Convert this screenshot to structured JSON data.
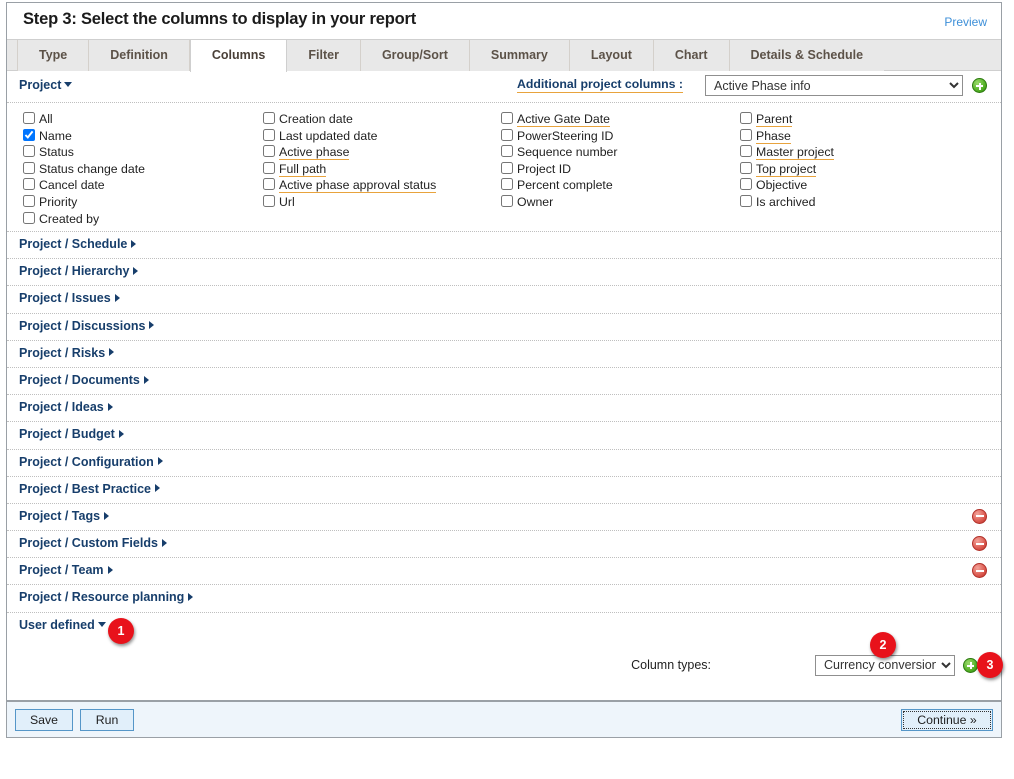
{
  "header": {
    "title": "Step 3: Select the columns to display in your report",
    "preview_label": "Preview"
  },
  "tabs": [
    {
      "label": "Type",
      "active": false
    },
    {
      "label": "Definition",
      "active": false
    },
    {
      "label": "Columns",
      "active": true
    },
    {
      "label": "Filter",
      "active": false
    },
    {
      "label": "Group/Sort",
      "active": false
    },
    {
      "label": "Summary",
      "active": false
    },
    {
      "label": "Layout",
      "active": false
    },
    {
      "label": "Chart",
      "active": false
    },
    {
      "label": "Details & Schedule",
      "active": false
    }
  ],
  "subbar": {
    "group_label": "Project",
    "additional_label": "Additional project columns :",
    "additional_selected": "Active Phase info",
    "add_icon": "plus-circle-icon"
  },
  "columns": {
    "col1": [
      {
        "label": "All",
        "checked": false,
        "hinted": false
      },
      {
        "label": "Name",
        "checked": true,
        "hinted": false
      },
      {
        "label": "Status",
        "checked": false,
        "hinted": false
      },
      {
        "label": "Status change date",
        "checked": false,
        "hinted": false
      },
      {
        "label": "Cancel date",
        "checked": false,
        "hinted": false
      },
      {
        "label": "Priority",
        "checked": false,
        "hinted": false
      },
      {
        "label": "Created by",
        "checked": false,
        "hinted": false
      }
    ],
    "col2": [
      {
        "label": "Creation date",
        "checked": false,
        "hinted": false
      },
      {
        "label": "Last updated date",
        "checked": false,
        "hinted": false
      },
      {
        "label": "Active phase",
        "checked": false,
        "hinted": true
      },
      {
        "label": "Full path",
        "checked": false,
        "hinted": true
      },
      {
        "label": "Active phase approval status",
        "checked": false,
        "hinted": true
      },
      {
        "label": "Url",
        "checked": false,
        "hinted": false
      }
    ],
    "col3": [
      {
        "label": "Active Gate Date",
        "checked": false,
        "hinted": true
      },
      {
        "label": "PowerSteering ID",
        "checked": false,
        "hinted": false
      },
      {
        "label": "Sequence number",
        "checked": false,
        "hinted": false
      },
      {
        "label": "Project ID",
        "checked": false,
        "hinted": false
      },
      {
        "label": "Percent complete",
        "checked": false,
        "hinted": false
      },
      {
        "label": "Owner",
        "checked": false,
        "hinted": false
      }
    ],
    "col4": [
      {
        "label": "Parent",
        "checked": false,
        "hinted": true
      },
      {
        "label": "Phase",
        "checked": false,
        "hinted": true
      },
      {
        "label": "Master project",
        "checked": false,
        "hinted": true
      },
      {
        "label": "Top project",
        "checked": false,
        "hinted": true
      },
      {
        "label": "Objective",
        "checked": false,
        "hinted": false
      },
      {
        "label": "Is archived",
        "checked": false,
        "hinted": false
      }
    ]
  },
  "sections": [
    {
      "label": "Project / Schedule",
      "removable": false
    },
    {
      "label": "Project / Hierarchy",
      "removable": false
    },
    {
      "label": "Project / Issues",
      "removable": false
    },
    {
      "label": "Project / Discussions",
      "removable": false
    },
    {
      "label": "Project / Risks",
      "removable": false
    },
    {
      "label": "Project / Documents",
      "removable": false
    },
    {
      "label": "Project / Ideas",
      "removable": false
    },
    {
      "label": "Project / Budget",
      "removable": false
    },
    {
      "label": "Project / Configuration",
      "removable": false
    },
    {
      "label": "Project / Best Practice",
      "removable": false
    },
    {
      "label": "Project / Tags",
      "removable": true
    },
    {
      "label": "Project / Custom Fields",
      "removable": true
    },
    {
      "label": "Project / Team",
      "removable": true
    },
    {
      "label": "Project / Resource planning",
      "removable": false
    }
  ],
  "user_defined": {
    "label": "User defined"
  },
  "column_types": {
    "label": "Column types:",
    "selected": "Currency conversion",
    "add_icon": "plus-circle-icon"
  },
  "badges": [
    {
      "number": "1"
    },
    {
      "number": "2"
    },
    {
      "number": "3"
    }
  ],
  "footer": {
    "save_label": "Save",
    "run_label": "Run",
    "continue_label": "Continue »"
  },
  "colors": {
    "accent_link": "#173e6b",
    "preview_link": "#3d8fd8",
    "hint_underline": "#e8a33d",
    "badge_red": "#e8121b",
    "add_green": "#4fae22",
    "remove_red": "#d9544a",
    "tab_active_bg": "#ffffff",
    "tab_bg": "#e8e8e8",
    "footer_bg": "#eef5fb"
  }
}
